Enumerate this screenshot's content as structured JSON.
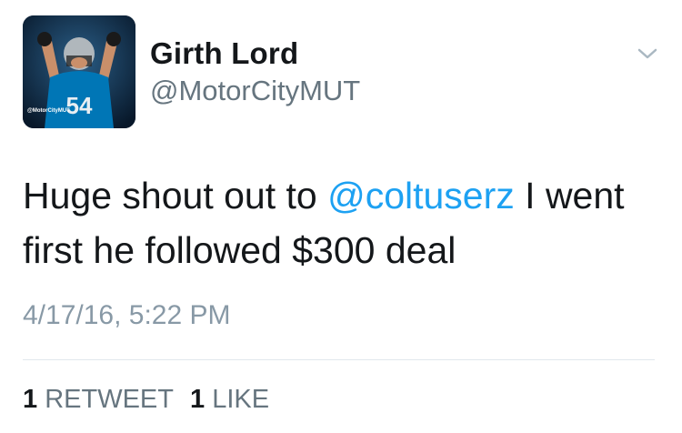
{
  "user": {
    "display_name": "Girth Lord",
    "handle": "@MotorCityMUT",
    "avatar_jersey_number": "54",
    "avatar_watermark": "@MotorCityMUT"
  },
  "tweet": {
    "text_before": "Huge shout out to ",
    "mention": "@coltuserz",
    "text_after": " I went first he followed $300 deal",
    "timestamp": "4/17/16, 5:22 PM"
  },
  "stats": {
    "retweets_count": "1",
    "retweets_label": "RETWEET",
    "likes_count": "1",
    "likes_label": "LIKE"
  },
  "icons": {
    "menu": "chevron-down-icon"
  },
  "colors": {
    "link": "#1da1f2",
    "secondary_text": "#66757f",
    "primary_text": "#14171a",
    "lions_blue": "#0076b6"
  }
}
